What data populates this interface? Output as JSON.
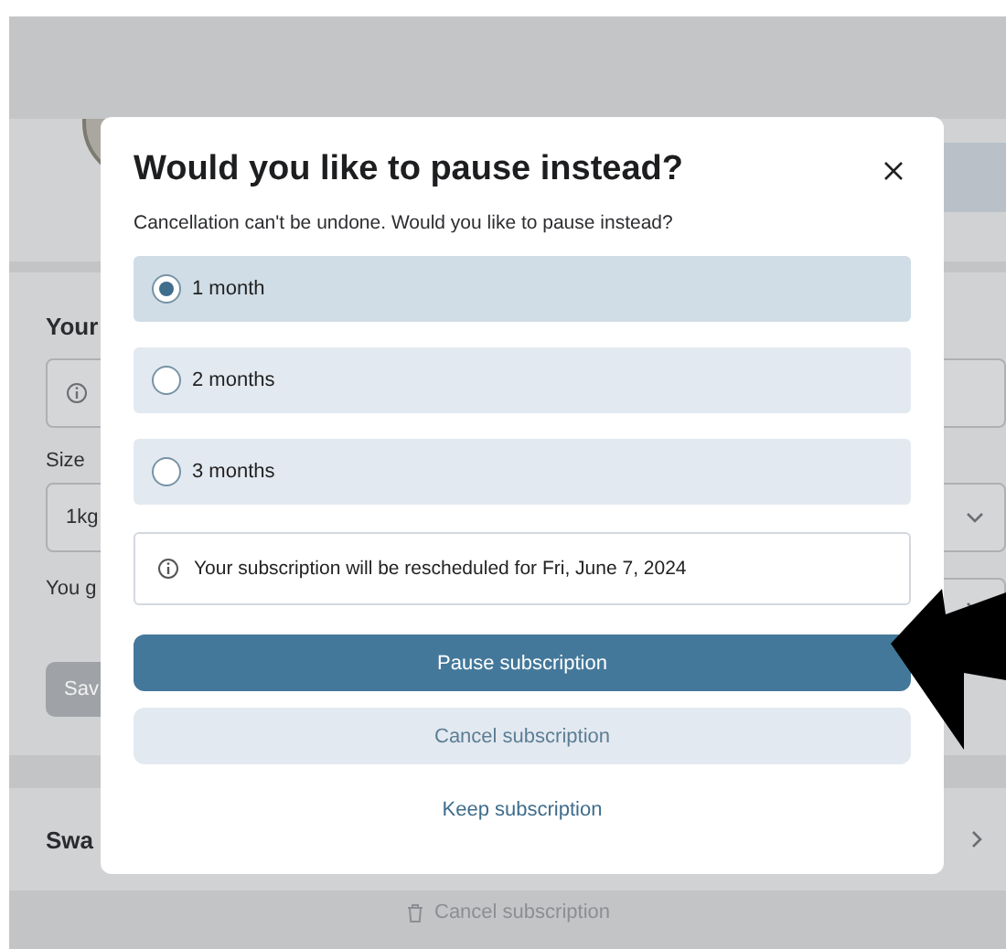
{
  "background": {
    "heading": "Your",
    "size_label": "Size",
    "size_value": "1kg",
    "quantity_label": "You g",
    "save_button": "Sav",
    "swap_label": "Swa",
    "cancel_link": "Cancel subscription"
  },
  "dialog": {
    "title": "Would you like to pause instead?",
    "subtitle": "Cancellation can't be undone. Would you like to pause instead?",
    "options": [
      {
        "label": "1 month",
        "selected": true
      },
      {
        "label": "2 months",
        "selected": false
      },
      {
        "label": "3 months",
        "selected": false
      }
    ],
    "notice": "Your subscription will be rescheduled for Fri, June 7, 2024",
    "buttons": [
      {
        "kind": "primary",
        "label": "Pause subscription"
      },
      {
        "kind": "secondary",
        "label": "Cancel subscription"
      },
      {
        "kind": "link",
        "label": "Keep subscription"
      }
    ]
  }
}
